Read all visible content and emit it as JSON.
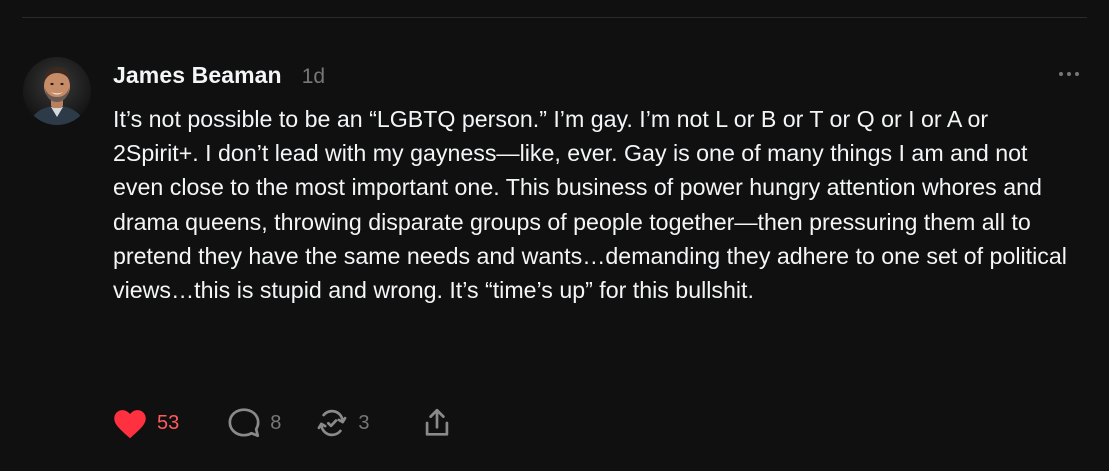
{
  "post": {
    "author": "James Beaman",
    "timestamp": "1d",
    "text": "It’s not possible to be an “LGBTQ person.” I’m gay. I’m not L or B or T or Q or I or A or 2Spirit+. I don’t lead with my gayness—like, ever. Gay is one of many things I am and not even close to the most important one. This business of power hungry attention whores and drama queens, throwing disparate groups of people together—then pressuring them all to pretend they have the same needs and wants…demanding they adhere to one set of political views…this is stupid and wrong. It’s “time’s up” for this bullshit."
  },
  "actions": {
    "like": {
      "icon": "heart-icon",
      "count": "53",
      "liked": true
    },
    "reply": {
      "icon": "comment-icon",
      "count": "8"
    },
    "repost": {
      "icon": "repost-icon",
      "count": "3"
    },
    "share": {
      "icon": "share-icon"
    }
  },
  "colors": {
    "background": "#101010",
    "text": "#f3f5f7",
    "muted": "#777777",
    "like": "#ff3040"
  }
}
